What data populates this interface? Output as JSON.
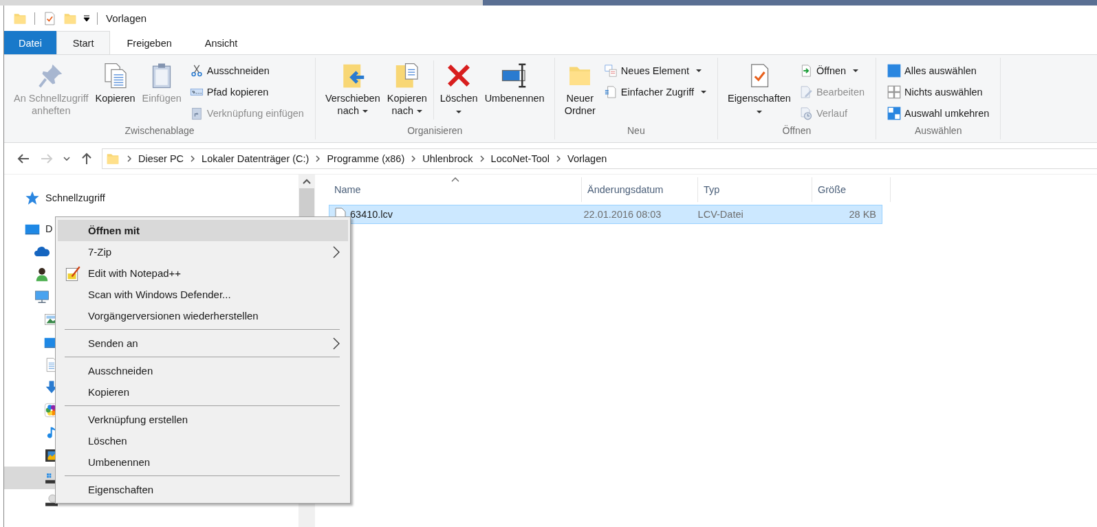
{
  "title_bar": {
    "title": "Vorlagen",
    "quick_access": [
      {
        "kind": "folder"
      },
      {
        "kind": "properties"
      },
      {
        "kind": "folder"
      }
    ]
  },
  "ribbon_tabs": [
    {
      "label": "Datei",
      "kind": "file",
      "selected": false
    },
    {
      "label": "Start",
      "kind": "tab",
      "selected": true
    },
    {
      "label": "Freigeben",
      "kind": "tab",
      "selected": false
    },
    {
      "label": "Ansicht",
      "kind": "tab",
      "selected": false
    }
  ],
  "ribbon_groups": [
    {
      "label": "Zwischenablage",
      "columns": [
        {
          "kind": "large",
          "buttons": [
            {
              "kind": "pin",
              "label": "An Schnellzugriff\nanheften",
              "disabled": true,
              "dropdown": false
            }
          ]
        },
        {
          "kind": "large",
          "buttons": [
            {
              "kind": "copy",
              "label": "Kopieren",
              "disabled": false,
              "dropdown": false
            }
          ]
        },
        {
          "kind": "large",
          "buttons": [
            {
              "kind": "clipboard",
              "label": "Einfügen",
              "disabled": true,
              "dropdown": false
            }
          ]
        },
        {
          "kind": "stack",
          "buttons": [
            {
              "kind": "scissors",
              "label": "Ausschneiden",
              "disabled": false,
              "dropdown": false
            },
            {
              "kind": "path",
              "label": "Pfad kopieren",
              "disabled": false,
              "dropdown": false
            },
            {
              "kind": "shortcut",
              "label": "Verknüpfung einfügen",
              "disabled": true,
              "dropdown": false
            }
          ]
        }
      ]
    },
    {
      "label": "Organisieren",
      "columns": [
        {
          "kind": "large",
          "buttons": [
            {
              "kind": "move",
              "label": "Verschieben\nnach",
              "disabled": false,
              "dropdown": true
            }
          ]
        },
        {
          "kind": "large",
          "buttons": [
            {
              "kind": "copyto",
              "label": "Kopieren\nnach",
              "disabled": false,
              "dropdown": true
            }
          ]
        },
        {
          "kind": "divider"
        },
        {
          "kind": "large",
          "buttons": [
            {
              "kind": "delete",
              "label": "Löschen",
              "disabled": false,
              "dropdown": true
            }
          ]
        },
        {
          "kind": "large",
          "buttons": [
            {
              "kind": "rename",
              "label": "Umbenennen",
              "disabled": false,
              "dropdown": false
            }
          ]
        }
      ]
    },
    {
      "label": "Neu",
      "columns": [
        {
          "kind": "large",
          "buttons": [
            {
              "kind": "newfolder",
              "label": "Neuer\nOrdner",
              "disabled": false,
              "dropdown": false
            }
          ]
        },
        {
          "kind": "stack",
          "buttons": [
            {
              "kind": "newitem",
              "label": "Neues Element",
              "disabled": false,
              "dropdown": true
            },
            {
              "kind": "easyaccess",
              "label": "Einfacher Zugriff",
              "disabled": false,
              "dropdown": true
            }
          ]
        }
      ]
    },
    {
      "label": "Öffnen",
      "columns": [
        {
          "kind": "large",
          "buttons": [
            {
              "kind": "properties",
              "label": "Eigenschaften",
              "disabled": false,
              "dropdown": true
            }
          ]
        },
        {
          "kind": "stack",
          "buttons": [
            {
              "kind": "open",
              "label": "Öffnen",
              "disabled": false,
              "dropdown": true
            },
            {
              "kind": "edit",
              "label": "Bearbeiten",
              "disabled": true,
              "dropdown": false
            },
            {
              "kind": "history",
              "label": "Verlauf",
              "disabled": true,
              "dropdown": false
            }
          ]
        }
      ]
    },
    {
      "label": "Auswählen",
      "columns": [
        {
          "kind": "stack",
          "buttons": [
            {
              "kind": "selectall",
              "label": "Alles auswählen",
              "disabled": false,
              "dropdown": false
            },
            {
              "kind": "selectnone",
              "label": "Nichts auswählen",
              "disabled": false,
              "dropdown": false
            },
            {
              "kind": "invert",
              "label": "Auswahl umkehren",
              "disabled": false,
              "dropdown": false
            }
          ]
        }
      ]
    }
  ],
  "address_bar": {
    "back_disabled": false,
    "forward_disabled": true,
    "breadcrumbs": [
      "Dieser PC",
      "Lokaler Datenträger (C:)",
      "Programme (x86)",
      "Uhlenbrock",
      "LocoNet-Tool",
      "Vorlagen"
    ]
  },
  "navigation": [
    {
      "kind": "star",
      "label": "Schnellzugriff",
      "selected": false
    },
    {
      "kind": "desktop",
      "label": "D",
      "selected": false,
      "children": [
        {
          "kind": "cloud",
          "selected": false
        },
        {
          "kind": "user",
          "selected": false
        },
        {
          "kind": "computer",
          "selected": false,
          "children": [
            {
              "kind": "pictures",
              "selected": false
            },
            {
              "kind": "desktop",
              "selected": false
            },
            {
              "kind": "documents",
              "selected": false
            },
            {
              "kind": "downloads",
              "selected": false
            },
            {
              "kind": "photos",
              "selected": false
            },
            {
              "kind": "music",
              "selected": false
            },
            {
              "kind": "videos",
              "selected": false
            },
            {
              "kind": "windrive",
              "selected": true
            },
            {
              "kind": "dvd",
              "selected": false
            }
          ]
        }
      ]
    }
  ],
  "file_list": {
    "columns": [
      {
        "label": "Name",
        "sorted": true
      },
      {
        "label": "Änderungsdatum",
        "sorted": false
      },
      {
        "label": "Typ",
        "sorted": false
      },
      {
        "label": "Größe",
        "sorted": false
      }
    ],
    "rows": [
      {
        "name": "63410.lcv",
        "date": "22.01.2016 08:03",
        "type": "LCV-Datei",
        "size": "28 KB",
        "selected": true
      }
    ]
  },
  "context_menu": [
    {
      "kind": "item",
      "label": "Öffnen mit",
      "default": true,
      "selected": true,
      "submenu": false
    },
    {
      "kind": "item",
      "label": "7-Zip",
      "default": false,
      "selected": false,
      "submenu": true
    },
    {
      "kind": "app",
      "label": "Edit with Notepad++",
      "default": false,
      "selected": false,
      "submenu": false
    },
    {
      "kind": "item",
      "label": "Scan with Windows Defender...",
      "default": false,
      "selected": false,
      "submenu": false
    },
    {
      "kind": "item",
      "label": "Vorgängerversionen wiederherstellen",
      "default": false,
      "selected": false,
      "submenu": false
    },
    {
      "kind": "separator"
    },
    {
      "kind": "item",
      "label": "Senden an",
      "default": false,
      "selected": false,
      "submenu": true
    },
    {
      "kind": "separator"
    },
    {
      "kind": "item",
      "label": "Ausschneiden",
      "default": false,
      "selected": false,
      "submenu": false
    },
    {
      "kind": "item",
      "label": "Kopieren",
      "default": false,
      "selected": false,
      "submenu": false
    },
    {
      "kind": "separator"
    },
    {
      "kind": "item",
      "label": "Verknüpfung erstellen",
      "default": false,
      "selected": false,
      "submenu": false
    },
    {
      "kind": "item",
      "label": "Löschen",
      "default": false,
      "selected": false,
      "submenu": false
    },
    {
      "kind": "item",
      "label": "Umbenennen",
      "default": false,
      "selected": false,
      "submenu": false
    },
    {
      "kind": "separator"
    },
    {
      "kind": "item",
      "label": "Eigenschaften",
      "default": false,
      "selected": false,
      "submenu": false
    }
  ]
}
